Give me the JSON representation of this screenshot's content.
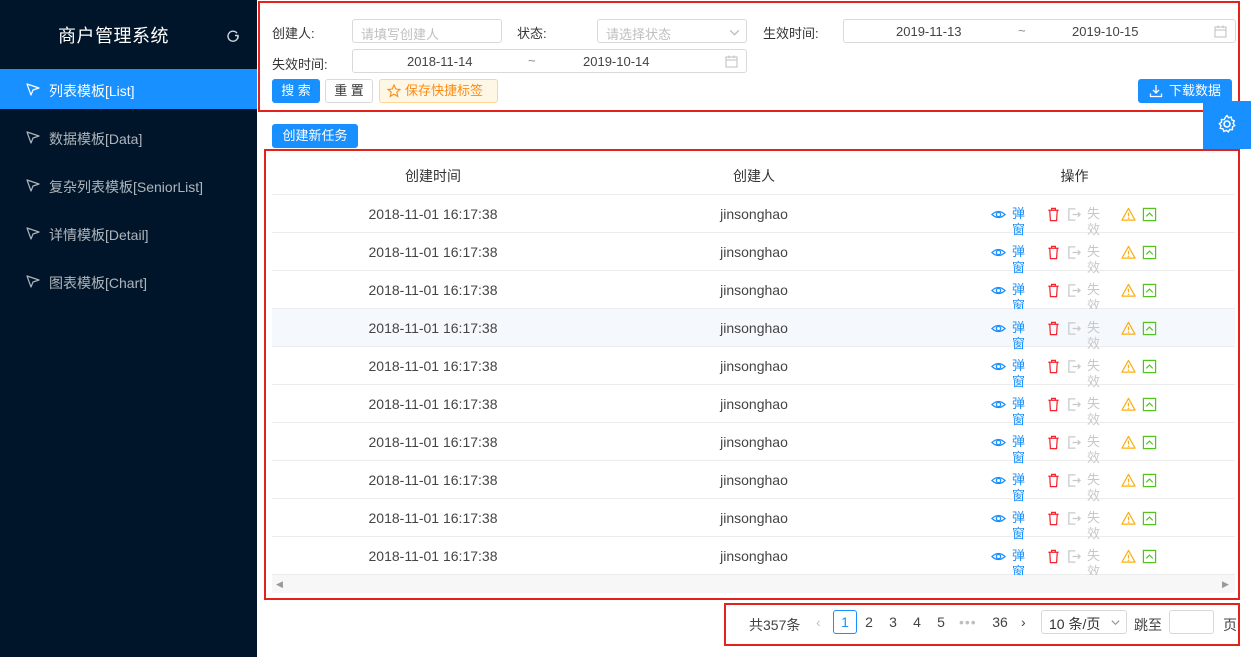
{
  "app": {
    "title": "商户管理系统"
  },
  "sidebar": {
    "items": [
      {
        "label": "列表模板[List]",
        "active": true
      },
      {
        "label": "数据模板[Data]",
        "active": false
      },
      {
        "label": "复杂列表模板[SeniorList]",
        "active": false
      },
      {
        "label": "详情模板[Detail]",
        "active": false
      },
      {
        "label": "图表模板[Chart]",
        "active": false
      }
    ]
  },
  "filters": {
    "creator_label": "创建人:",
    "creator_placeholder": "请填写创建人",
    "status_label": "状态:",
    "status_placeholder": "请选择状态",
    "effective_label": "生效时间:",
    "effective_start": "2019-11-13",
    "effective_sep": "~",
    "effective_end": "2019-10-15",
    "expire_label": "失效时间:",
    "expire_start": "2018-11-14",
    "expire_sep": "~",
    "expire_end": "2019-10-14"
  },
  "actions": {
    "search": "搜 索",
    "reset": "重 置",
    "save_tag": "保存快捷标签",
    "download": "下载数据",
    "create_task": "创建新任务"
  },
  "table": {
    "columns": [
      "创建时间",
      "创建人",
      "操作"
    ],
    "row_ops": {
      "popup": "弹窗",
      "invalid": "失效"
    },
    "rows": [
      {
        "time": "2018-11-01 16:17:38",
        "creator": "jinsonghao"
      },
      {
        "time": "2018-11-01 16:17:38",
        "creator": "jinsonghao"
      },
      {
        "time": "2018-11-01 16:17:38",
        "creator": "jinsonghao"
      },
      {
        "time": "2018-11-01 16:17:38",
        "creator": "jinsonghao"
      },
      {
        "time": "2018-11-01 16:17:38",
        "creator": "jinsonghao"
      },
      {
        "time": "2018-11-01 16:17:38",
        "creator": "jinsonghao"
      },
      {
        "time": "2018-11-01 16:17:38",
        "creator": "jinsonghao"
      },
      {
        "time": "2018-11-01 16:17:38",
        "creator": "jinsonghao"
      },
      {
        "time": "2018-11-01 16:17:38",
        "creator": "jinsonghao"
      },
      {
        "time": "2018-11-01 16:17:38",
        "creator": "jinsonghao"
      }
    ]
  },
  "pagination": {
    "total": "共357条",
    "pages": [
      "1",
      "2",
      "3",
      "4",
      "5"
    ],
    "current": "1",
    "ellipsis": "•••",
    "last": "36",
    "page_size": "10 条/页",
    "jump_label": "跳至",
    "page_suffix": "页"
  },
  "colors": {
    "sidebar_bg": "#001529",
    "primary": "#1890ff",
    "danger": "#f5222d",
    "warning": "#faad14",
    "success": "#52c41a",
    "highlight_box": "#e3221b"
  }
}
